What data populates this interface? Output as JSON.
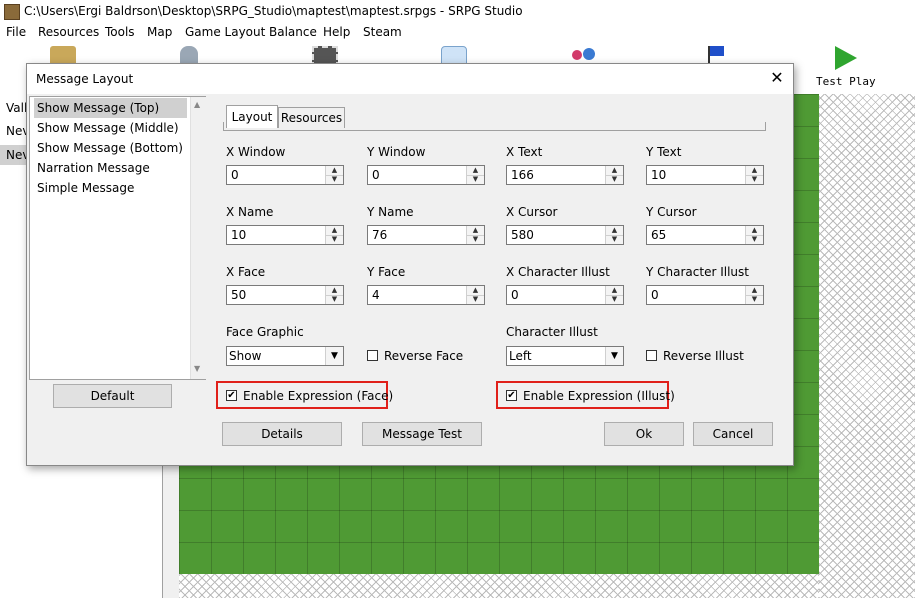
{
  "window": {
    "title": "C:\\Users\\Ergi Baldrson\\Desktop\\SRPG_Studio\\maptest\\maptest.srpgs - SRPG Studio"
  },
  "menu": [
    "File",
    "Resources",
    "Tools",
    "Map",
    "Game Layout",
    "Balance",
    "Help",
    "Steam"
  ],
  "toolbar": {
    "test_play_label": "Test Play",
    "icons": [
      "resource-icon",
      "database-icon",
      "film-icon",
      "window-icon",
      "characters-icon",
      "flag-icon",
      "play-icon"
    ]
  },
  "left_panel": {
    "items": [
      "Valle",
      "Nev",
      "Nev"
    ]
  },
  "dialog": {
    "title": "Message Layout",
    "close": "✕",
    "list": [
      "Show Message (Top)",
      "Show Message (Middle)",
      "Show Message (Bottom)",
      "Narration Message",
      "Simple Message"
    ],
    "default_button": "Default",
    "tabs": [
      "Layout",
      "Resources"
    ],
    "fields": {
      "x_window": {
        "label": "X Window",
        "value": "0"
      },
      "y_window": {
        "label": "Y Window",
        "value": "0"
      },
      "x_text": {
        "label": "X Text",
        "value": "166"
      },
      "y_text": {
        "label": "Y Text",
        "value": "10"
      },
      "x_name": {
        "label": "X Name",
        "value": "10"
      },
      "y_name": {
        "label": "Y Name",
        "value": "76"
      },
      "x_cursor": {
        "label": "X Cursor",
        "value": "580"
      },
      "y_cursor": {
        "label": "Y Cursor",
        "value": "65"
      },
      "x_face": {
        "label": "X Face",
        "value": "50"
      },
      "y_face": {
        "label": "Y Face",
        "value": "4"
      },
      "x_char_illust": {
        "label": "X Character Illust",
        "value": "0"
      },
      "y_char_illust": {
        "label": "Y Character Illust",
        "value": "0"
      }
    },
    "face_graphic": {
      "label": "Face Graphic",
      "value": "Show"
    },
    "reverse_face": {
      "label": "Reverse Face",
      "checked": false
    },
    "character_illust": {
      "label": "Character Illust",
      "value": "Left"
    },
    "reverse_illust": {
      "label": "Reverse Illust",
      "checked": false
    },
    "enable_expression_face": {
      "label": "Enable Expression (Face)",
      "checked": true
    },
    "enable_expression_illust": {
      "label": "Enable Expression (Illust)",
      "checked": true
    },
    "buttons": {
      "details": "Details",
      "message_test": "Message Test",
      "ok": "Ok",
      "cancel": "Cancel"
    },
    "check_mark": "✔"
  },
  "colors": {
    "highlight_box": "#e0201a",
    "map_grass": "#4f9a34"
  }
}
